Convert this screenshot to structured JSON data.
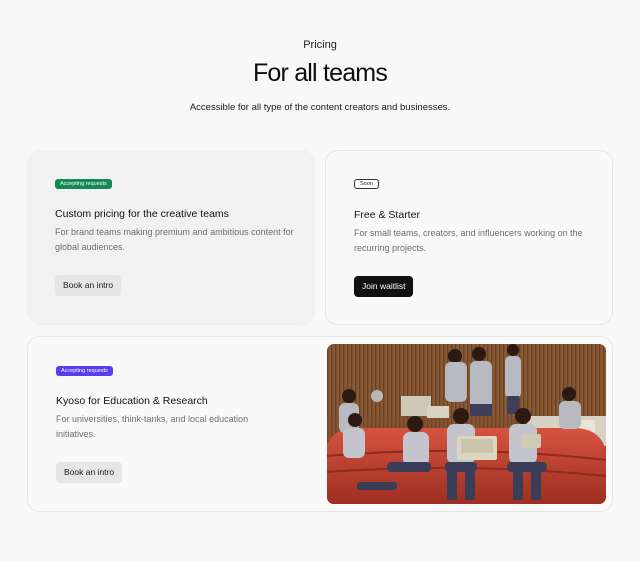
{
  "header": {
    "eyebrow": "Pricing",
    "title": "For all teams",
    "subtitle": "Accessible for all type of the content creators and businesses."
  },
  "plans": [
    {
      "badge": "Accepting requests",
      "title": "Custom pricing for the creative teams",
      "description": "For brand teams making premium and ambitious content for global audiences.",
      "button": "Book an intro",
      "badge_color": "#138a55"
    },
    {
      "badge": "Soon",
      "title": "Free & Starter",
      "description": "For small teams, creators, and influencers working on the recurring projects.",
      "button": "Join waitlist"
    },
    {
      "badge": "Accepting requests",
      "title": "Kyoso for Education & Research",
      "description": "For universities, think-tanks, and local education initiatives.",
      "button": "Book an intro",
      "badge_color": "#5a3df0"
    }
  ],
  "colors": {
    "background": "#f8f8f8",
    "accent_green": "#138a55",
    "accent_purple": "#5a3df0",
    "button_dark": "#111111"
  }
}
